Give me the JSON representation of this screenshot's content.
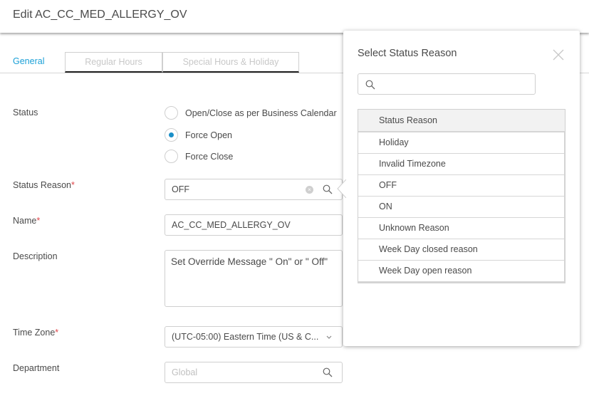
{
  "header": {
    "title": "Edit AC_CC_MED_ALLERGY_OV"
  },
  "tabs": [
    {
      "label": "General",
      "active": true
    },
    {
      "label": "Regular Hours",
      "active": false
    },
    {
      "label": "Special Hours & Holiday",
      "active": false
    }
  ],
  "form": {
    "status": {
      "label": "Status",
      "options": [
        {
          "label": "Open/Close as per Business Calendar",
          "checked": false
        },
        {
          "label": "Force Open",
          "checked": true
        },
        {
          "label": "Force Close",
          "checked": false
        }
      ]
    },
    "status_reason": {
      "label": "Status Reason",
      "required_mark": "*",
      "value": "OFF",
      "clear_icon": "clear-icon",
      "search_icon": "search-icon"
    },
    "name": {
      "label": "Name",
      "required_mark": "*",
      "value": "AC_CC_MED_ALLERGY_OV"
    },
    "description": {
      "label": "Description",
      "value": "Set Override Message \" On\"  or \" Off\""
    },
    "time_zone": {
      "label": "Time Zone",
      "required_mark": "*",
      "value": "(UTC-05:00) Eastern Time (US & C...",
      "icon": "chevron-down-icon"
    },
    "department": {
      "label": "Department",
      "placeholder": "Global",
      "icon": "search-icon"
    }
  },
  "popup": {
    "title": "Select Status Reason",
    "close_icon": "close-icon",
    "search_placeholder": "",
    "column_header": "Status Reason",
    "rows": [
      "Holiday",
      "Invalid Timezone",
      "OFF",
      "ON",
      "Unknown Reason",
      "Week Day closed reason",
      "Week Day open reason"
    ]
  },
  "colors": {
    "accent": "#1ba0d7",
    "required": "#e0464b",
    "radio_selected": "#1b8fc8"
  }
}
